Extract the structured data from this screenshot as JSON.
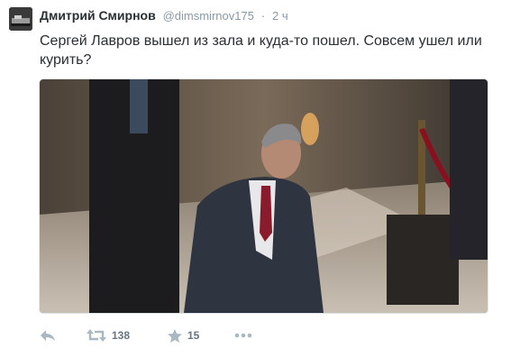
{
  "tweet": {
    "author_name": "Дмитрий Смирнов",
    "author_handle": "@dimsmirnov175",
    "separator": "·",
    "time": "2 ч",
    "text": "Сергей Лавров вышел из зала и куда-то пошел. Совсем ушел или курить?",
    "photo_icon": "photo-of-man-in-dark-suit-in-hall"
  },
  "actions": {
    "reply_icon": "reply-icon",
    "retweet_icon": "retweet-icon",
    "retweet_count": "138",
    "favorite_icon": "star-icon",
    "favorite_count": "15",
    "more_icon": "more-dots-icon"
  },
  "colors": {
    "text": "#292f33",
    "secondary": "#8899a6",
    "action_count": "#66757f"
  }
}
